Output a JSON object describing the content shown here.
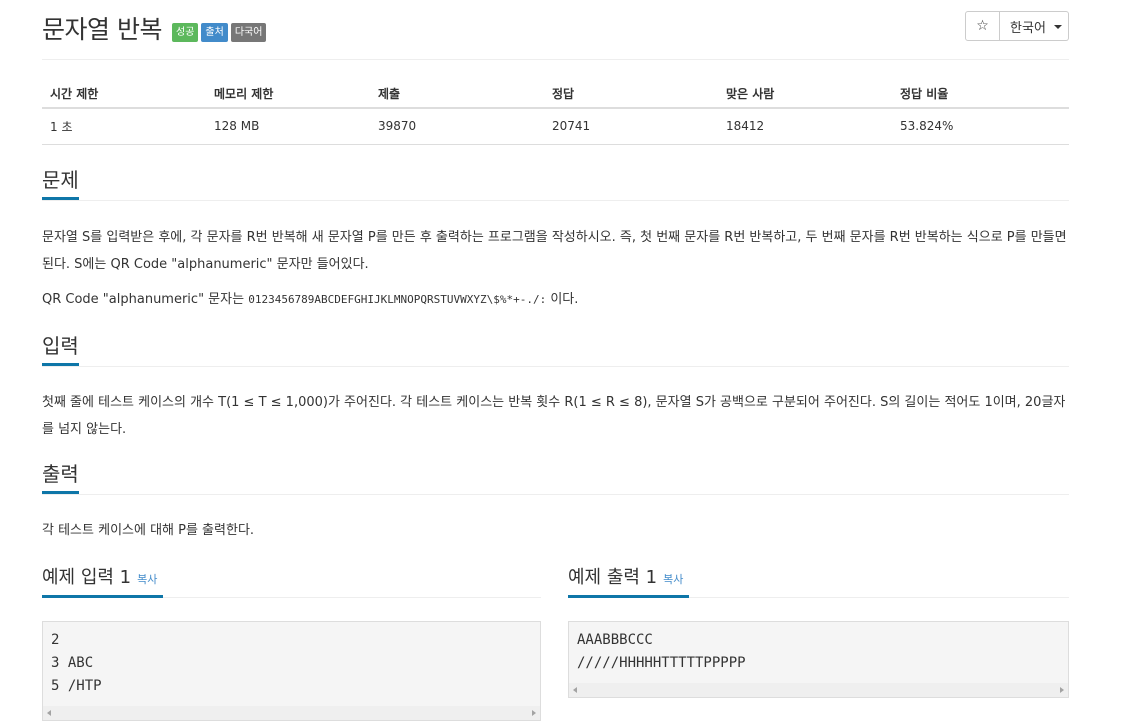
{
  "problem": {
    "title": "문자열 반복",
    "badges": [
      {
        "label": "성공",
        "color": "#5cb85c"
      },
      {
        "label": "출처",
        "color": "#428bca"
      },
      {
        "label": "다국어",
        "color": "#777777"
      }
    ]
  },
  "toolbar": {
    "star_glyph": "☆",
    "language": "한국어"
  },
  "info": {
    "headers": [
      "시간 제한",
      "메모리 제한",
      "제출",
      "정답",
      "맞은 사람",
      "정답 비율"
    ],
    "values": [
      "1 초",
      "128 MB",
      "39870",
      "20741",
      "18412",
      "53.824%"
    ]
  },
  "description": {
    "heading": "문제",
    "para1": "문자열 S를 입력받은 후에, 각 문자를 R번 반복해 새 문자열 P를 만든 후 출력하는 프로그램을 작성하시오. 즉, 첫 번째 문자를 R번 반복하고, 두 번째 문자를 R번 반복하는 식으로 P를 만들면 된다. S에는 QR Code \"alphanumeric\" 문자만 들어있다.",
    "para2_prefix": "QR Code \"alphanumeric\" 문자는 ",
    "para2_code": "0123456789ABCDEFGHIJKLMNOPQRSTUVWXYZ\\$%*+-./:",
    "para2_suffix": " 이다."
  },
  "input": {
    "heading": "입력",
    "text": "첫째 줄에 테스트 케이스의 개수 T(1 ≤ T ≤ 1,000)가 주어진다. 각 테스트 케이스는 반복 횟수 R(1 ≤ R ≤ 8), 문자열 S가 공백으로 구분되어 주어진다. S의 길이는 적어도 1이며, 20글자를 넘지 않는다."
  },
  "output": {
    "heading": "출력",
    "text": "각 테스트 케이스에 대해 P를 출력한다."
  },
  "samples": {
    "input": {
      "heading": "예제 입력 1",
      "copy": "복사",
      "lines": [
        "2",
        "3 ABC",
        "5 /HTP"
      ]
    },
    "output": {
      "heading": "예제 출력 1",
      "copy": "복사",
      "lines": [
        "AAABBBCCC",
        "/////HHHHHTTTTTPPPPP"
      ]
    }
  }
}
